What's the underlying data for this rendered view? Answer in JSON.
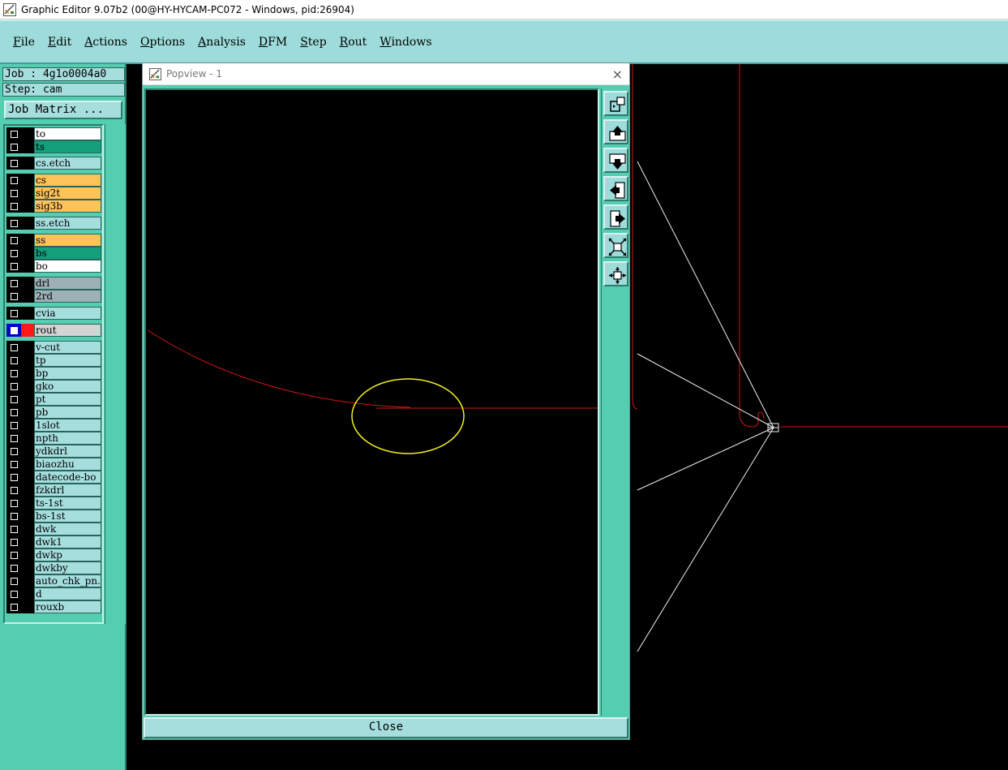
{
  "window": {
    "title": "Graphic Editor 9.07b2 (00@HY-HYCAM-PC072 - Windows, pid:26904)"
  },
  "menu": [
    {
      "label": "File"
    },
    {
      "label": "Edit"
    },
    {
      "label": "Actions"
    },
    {
      "label": "Options"
    },
    {
      "label": "Analysis"
    },
    {
      "label": "DFM"
    },
    {
      "label": "Step"
    },
    {
      "label": "Rout"
    },
    {
      "label": "Windows"
    }
  ],
  "panel": {
    "job": "Job : 4g1o0004a0",
    "step": "Step: cam",
    "job_matrix": "Job Matrix ..."
  },
  "colors": {
    "white": "#ffffff",
    "green": "#13a07b",
    "orange": "#ffc35a",
    "gray": "#9db0b5",
    "cyan": "#a6dede",
    "lightgray": "#d4d4d4",
    "active_red": "#ff1818",
    "active_blue": "#0000c8"
  },
  "layers": [
    {
      "name": "to",
      "bg": "#ffffff"
    },
    {
      "name": "ts",
      "bg": "#13a07b"
    },
    {
      "name": "cs.etch",
      "bg": "#a6dede"
    },
    {
      "name": "cs",
      "bg": "#ffc35a"
    },
    {
      "name": "sig2t",
      "bg": "#ffc35a"
    },
    {
      "name": "sig3b",
      "bg": "#ffc35a"
    },
    {
      "name": "ss.etch",
      "bg": "#a6dede"
    },
    {
      "name": "ss",
      "bg": "#ffc35a"
    },
    {
      "name": "bs",
      "bg": "#13a07b"
    },
    {
      "name": "bo",
      "bg": "#ffffff"
    },
    {
      "name": "drl",
      "bg": "#9db0b5"
    },
    {
      "name": "2rd",
      "bg": "#9db0b5"
    },
    {
      "name": "cvia",
      "bg": "#a6dede"
    },
    {
      "name": "rout",
      "bg": "#d4d4d4",
      "active": true
    },
    {
      "name": "v-cut",
      "bg": "#a6dede"
    },
    {
      "name": "tp",
      "bg": "#a6dede"
    },
    {
      "name": "bp",
      "bg": "#a6dede"
    },
    {
      "name": "gko",
      "bg": "#a6dede"
    },
    {
      "name": "pt",
      "bg": "#a6dede"
    },
    {
      "name": "pb",
      "bg": "#a6dede"
    },
    {
      "name": "1slot",
      "bg": "#a6dede"
    },
    {
      "name": "npth",
      "bg": "#a6dede"
    },
    {
      "name": "ydkdrl",
      "bg": "#a6dede"
    },
    {
      "name": "biaozhu",
      "bg": "#a6dede"
    },
    {
      "name": "datecode-bo",
      "bg": "#a6dede"
    },
    {
      "name": "fzkdrl",
      "bg": "#a6dede"
    },
    {
      "name": "ts-1st",
      "bg": "#a6dede"
    },
    {
      "name": "bs-1st",
      "bg": "#a6dede"
    },
    {
      "name": "dwk",
      "bg": "#a6dede"
    },
    {
      "name": "dwk1",
      "bg": "#a6dede"
    },
    {
      "name": "dwkp",
      "bg": "#a6dede"
    },
    {
      "name": "dwkby",
      "bg": "#a6dede"
    },
    {
      "name": "auto_chk_pn.",
      "bg": "#a6dede"
    },
    {
      "name": "d",
      "bg": "#a6dede"
    },
    {
      "name": "rouxb",
      "bg": "#a6dede"
    }
  ],
  "popview": {
    "title": "Popview - 1",
    "close_x": "×",
    "close_label": "Close",
    "tools": [
      {
        "icon": "zoom-window-icon"
      },
      {
        "icon": "pan-up-icon"
      },
      {
        "icon": "pan-down-icon"
      },
      {
        "icon": "pan-left-icon"
      },
      {
        "icon": "pan-right-icon"
      },
      {
        "icon": "zoom-out-icon"
      },
      {
        "icon": "zoom-in-icon"
      }
    ]
  }
}
